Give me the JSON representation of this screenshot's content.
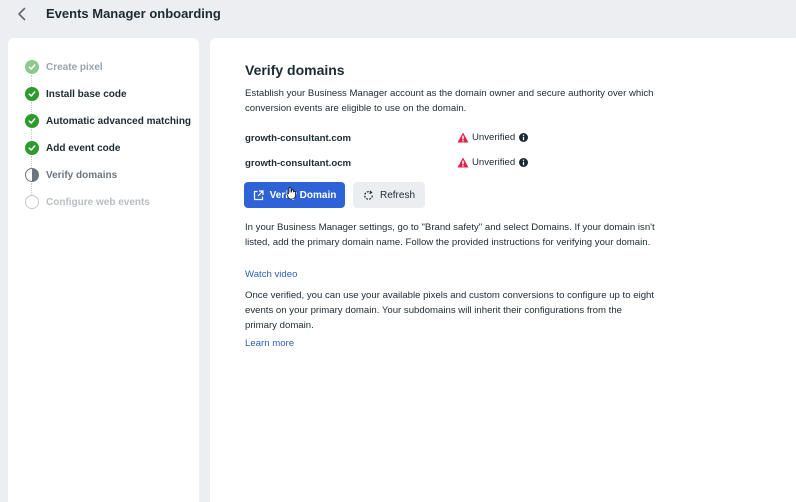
{
  "header": {
    "title": "Events Manager onboarding"
  },
  "icons": {
    "back": "chevron-left-icon",
    "done": "check-circle-icon",
    "current": "half-circle-icon",
    "future": "empty-circle-icon",
    "warning": "warning-triangle-icon",
    "info": "info-icon",
    "external": "external-link-icon",
    "refresh": "refresh-icon"
  },
  "colors": {
    "primary": "#2d63d6",
    "success": "#2c9a2c",
    "warning": "#e0234e",
    "link": "#2d5fbf"
  },
  "steps": [
    {
      "label": "Create pixel",
      "status": "done-muted"
    },
    {
      "label": "Install base code",
      "status": "done"
    },
    {
      "label": "Automatic advanced matching",
      "status": "done"
    },
    {
      "label": "Add event code",
      "status": "done"
    },
    {
      "label": "Verify domains",
      "status": "current"
    },
    {
      "label": "Configure web events",
      "status": "future"
    }
  ],
  "main": {
    "title": "Verify domains",
    "intro": "Establish your Business Manager account as the domain owner and secure authority over which conversion events are eligible to use on the domain.",
    "domains": [
      {
        "name": "growth-consultant.com",
        "status": "Unverified"
      },
      {
        "name": "growth-consultant.ocm",
        "status": "Unverified"
      }
    ],
    "verify_button": "Verify Domain",
    "refresh_button": "Refresh",
    "instructions": "In your Business Manager settings, go to \"Brand safety\" and select Domains. If your domain isn't listed, add the primary domain name. Follow the provided instructions for verifying your domain.",
    "watch_video": "Watch video",
    "details": "Once verified, you can use your available pixels and custom conversions to configure up to eight events on your primary domain. Your subdomains will inherit their configurations from the primary domain.",
    "learn_more": "Learn more"
  }
}
